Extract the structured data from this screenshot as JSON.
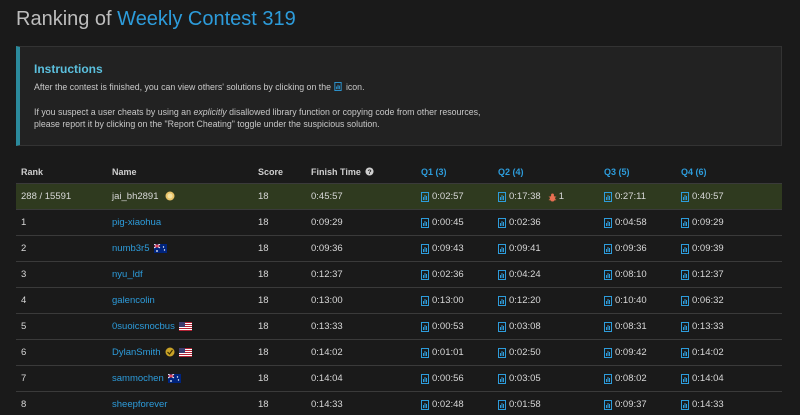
{
  "title": {
    "prefix": "Ranking of ",
    "contest": "Weekly Contest 319"
  },
  "instructions": {
    "heading": "Instructions",
    "line1_before": "After the contest is finished, you can view others' solutions by clicking on the",
    "line1_after": "icon.",
    "line2_before": "If you suspect a user cheats by using an",
    "line2_em": "explicitly",
    "line2_after": "disallowed library function or copying code from other resources,",
    "line3": "please report it by clicking on the \"Report Cheating\" toggle under the suspicious solution."
  },
  "table": {
    "headers": {
      "rank": "Rank",
      "name": "Name",
      "score": "Score",
      "finish": "Finish Time",
      "q1": "Q1 (3)",
      "q2": "Q2 (4)",
      "q3": "Q3 (5)",
      "q4": "Q4 (6)"
    },
    "me": {
      "rank": "288 / 15591",
      "name": "jai_bh2891",
      "score": "18",
      "finish": "0:45:57",
      "q1": "0:02:57",
      "q2": "0:17:38",
      "q2_penalty": "1",
      "q3": "0:27:11",
      "q4": "0:40:57"
    },
    "rows": [
      {
        "rank": "1",
        "name": "pig-xiaohua",
        "score": "18",
        "finish": "0:09:29",
        "q1": "0:00:45",
        "q2": "0:02:36",
        "q3": "0:04:58",
        "q4": "0:09:29"
      },
      {
        "rank": "2",
        "name": "numb3r5",
        "score": "18",
        "finish": "0:09:36",
        "q1": "0:09:43",
        "q2": "0:09:41",
        "q3": "0:09:36",
        "q4": "0:09:39"
      },
      {
        "rank": "3",
        "name": "nyu_ldf",
        "score": "18",
        "finish": "0:12:37",
        "q1": "0:02:36",
        "q2": "0:04:24",
        "q3": "0:08:10",
        "q4": "0:12:37"
      },
      {
        "rank": "4",
        "name": "galencolin",
        "score": "18",
        "finish": "0:13:00",
        "q1": "0:13:00",
        "q2": "0:12:20",
        "q3": "0:10:40",
        "q4": "0:06:32"
      },
      {
        "rank": "5",
        "name": "0suoicsnocbus",
        "score": "18",
        "finish": "0:13:33",
        "q1": "0:00:53",
        "q2": "0:03:08",
        "q3": "0:08:31",
        "q4": "0:13:33"
      },
      {
        "rank": "6",
        "name": "DylanSmith",
        "score": "18",
        "finish": "0:14:02",
        "q1": "0:01:01",
        "q2": "0:02:50",
        "q3": "0:09:42",
        "q4": "0:14:02"
      },
      {
        "rank": "7",
        "name": "sammochen",
        "score": "18",
        "finish": "0:14:04",
        "q1": "0:00:56",
        "q2": "0:03:05",
        "q3": "0:08:02",
        "q4": "0:14:04"
      },
      {
        "rank": "8",
        "name": "sheepforever",
        "score": "18",
        "finish": "0:14:33",
        "q1": "0:02:48",
        "q2": "0:01:58",
        "q3": "0:09:37",
        "q4": "0:14:33"
      }
    ]
  },
  "colors": {
    "accent": "#2d9cdb",
    "highlight_row": "#2f3a1f",
    "instructions_border": "#2b8a9c"
  }
}
